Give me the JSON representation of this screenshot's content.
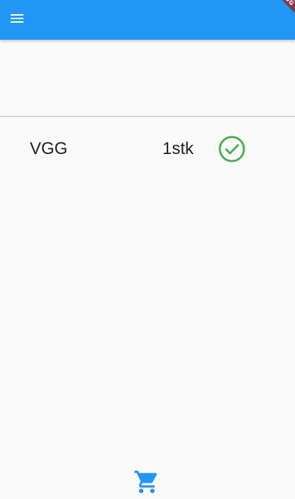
{
  "appbar": {
    "color": "#2196f3",
    "menu_icon": "menu-icon",
    "debug_banner": "DEBUG"
  },
  "list": {
    "items": [
      {
        "name": "VGG",
        "quantity": "1stk",
        "status_icon": "check-circle-icon",
        "status_color": "#4caf50"
      }
    ]
  },
  "bottom": {
    "cart_icon": "shopping-cart-icon",
    "cart_color": "#2196f3"
  }
}
